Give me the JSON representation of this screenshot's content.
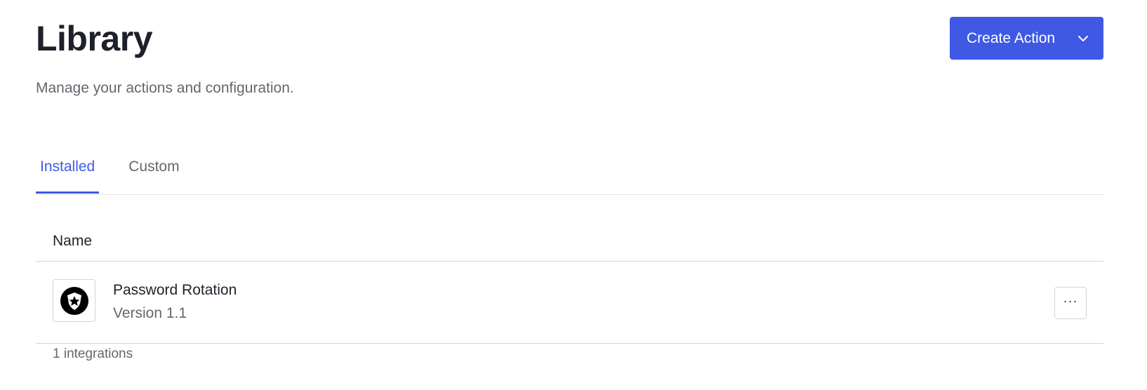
{
  "header": {
    "title": "Library",
    "subtitle": "Manage your actions and configuration.",
    "create_button_label": "Create Action"
  },
  "tabs": [
    {
      "label": "Installed",
      "active": true
    },
    {
      "label": "Custom",
      "active": false
    }
  ],
  "table": {
    "columns": [
      "Name"
    ],
    "rows": [
      {
        "title": "Password Rotation",
        "version": "Version 1.1",
        "icon": "auth0-shield-icon"
      }
    ]
  },
  "footer": {
    "count_text": "1 integrations"
  },
  "colors": {
    "accent": "#3f59e4",
    "text": "#1e212a",
    "muted": "#65676e",
    "border": "#d4d5d8"
  },
  "icons": {
    "create_chevron": "chevron-down-icon",
    "row_menu": "more-horizontal-icon"
  }
}
